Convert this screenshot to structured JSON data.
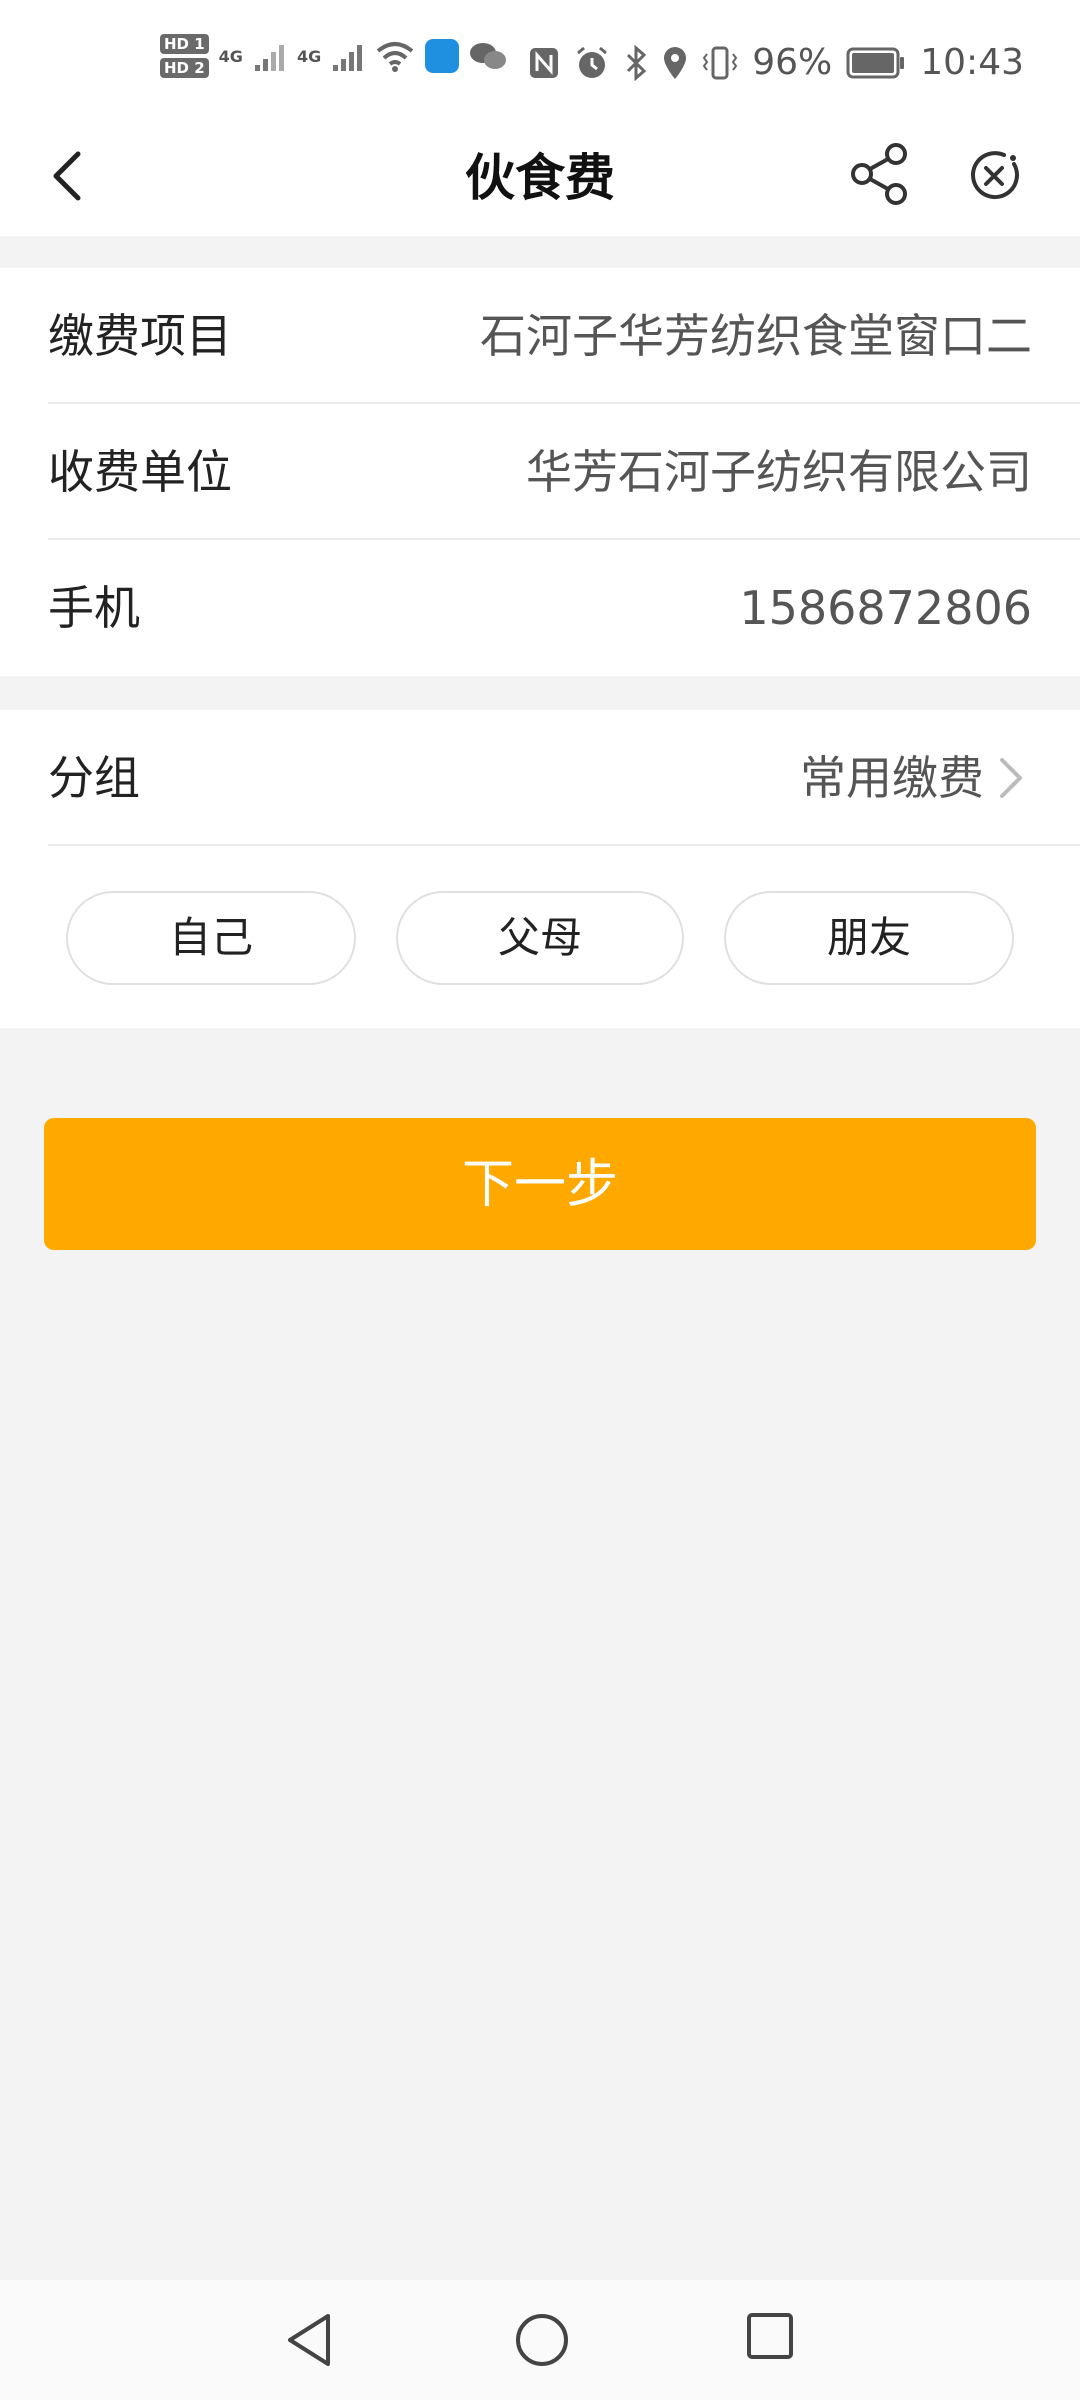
{
  "status_bar": {
    "hd1": "HD 1",
    "hd2": "HD 2",
    "net1": "4G",
    "net2": "4G",
    "battery": "96%",
    "time": "10:43",
    "icons": [
      "signal-icon",
      "wifi-icon",
      "app-notification-icon",
      "wechat-icon",
      "nfc-icon",
      "alarm-icon",
      "bluetooth-icon",
      "location-icon",
      "vibrate-icon",
      "battery-icon"
    ]
  },
  "nav": {
    "title": "伙食费",
    "icons": [
      "back-arrow-icon",
      "share-icon",
      "close-mini-program-icon"
    ]
  },
  "details": [
    {
      "label": "缴费项目",
      "value": "石河子华芳纺织食堂窗口二"
    },
    {
      "label": "收费单位",
      "value": "华芳石河子纺织有限公司"
    },
    {
      "label": "手机",
      "value": "1586872806"
    }
  ],
  "group": {
    "label": "分组",
    "value": "常用缴费",
    "options": [
      "自己",
      "父母",
      "朋友"
    ]
  },
  "next_button": "下一步",
  "colors": {
    "accent": "#ffa800",
    "background": "#f3f3f3",
    "card": "#ffffff",
    "divider": "#ececec"
  }
}
